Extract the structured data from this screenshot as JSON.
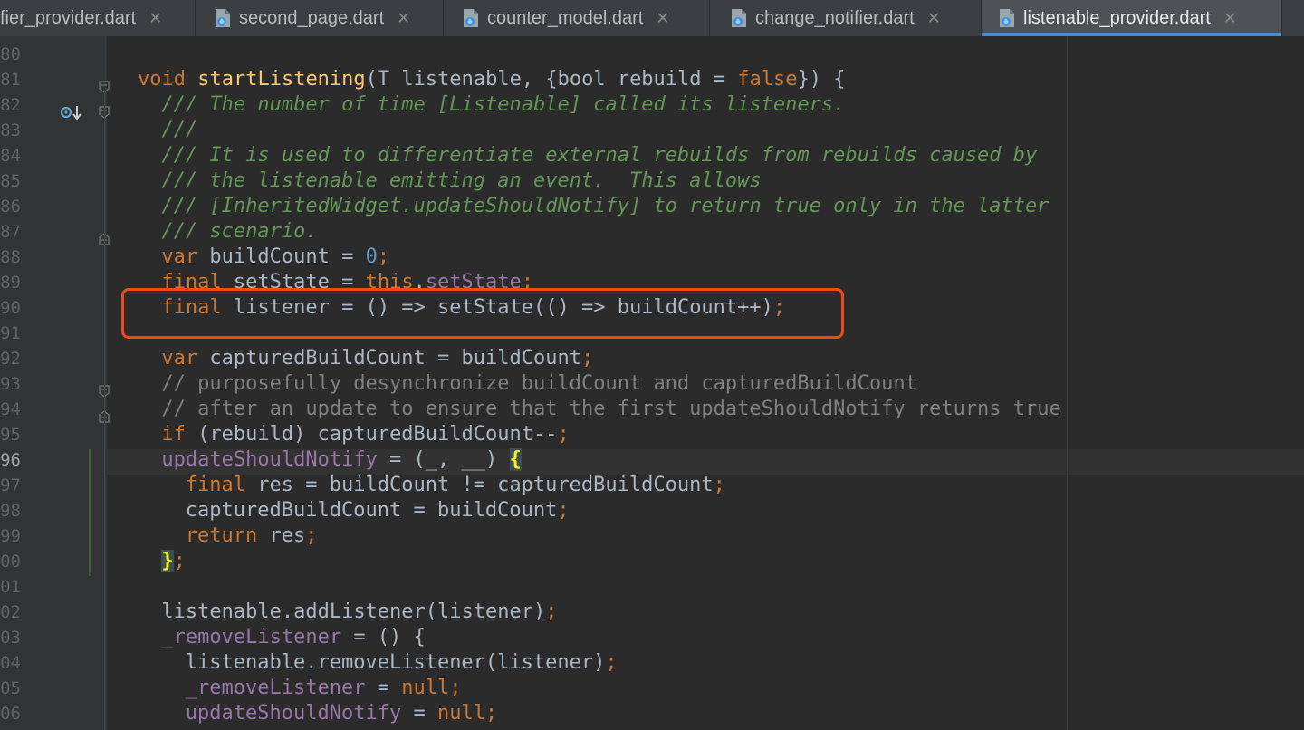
{
  "tabs": [
    {
      "label": "fier_provider.dart",
      "active": false
    },
    {
      "label": "second_page.dart",
      "active": false
    },
    {
      "label": "counter_model.dart",
      "active": false
    },
    {
      "label": "change_notifier.dart",
      "active": false
    },
    {
      "label": "listenable_provider.dart",
      "active": true
    }
  ],
  "tab_close_glyph": "✕",
  "icons": {
    "tab_file": "dart-file-icon",
    "gutter": "override-method-icon",
    "fold": "fold-marker-icon"
  },
  "highlight_color": "#f04a17",
  "current_line_number": "96",
  "lines": [
    {
      "num": "80",
      "segments": []
    },
    {
      "num": "81",
      "segments": [
        [
          "kw",
          "void "
        ],
        [
          "fn",
          "startListening"
        ],
        [
          "pl",
          "(T listenable, {"
        ],
        [
          "pl",
          "bool rebuild = "
        ],
        [
          "kw",
          "false"
        ],
        [
          "pl",
          "}) {"
        ]
      ]
    },
    {
      "num": "82",
      "segments": [
        [
          "doc",
          "/// The number of time [Listenable] called its listeners."
        ]
      ]
    },
    {
      "num": "83",
      "segments": [
        [
          "doc",
          "///"
        ]
      ]
    },
    {
      "num": "84",
      "segments": [
        [
          "doc",
          "/// It is used to differentiate external rebuilds from rebuilds caused by"
        ]
      ]
    },
    {
      "num": "85",
      "segments": [
        [
          "doc",
          "/// the listenable emitting an event.  This allows"
        ]
      ]
    },
    {
      "num": "86",
      "segments": [
        [
          "doc",
          "/// [InheritedWidget.updateShouldNotify] to return true only in the latter"
        ]
      ]
    },
    {
      "num": "87",
      "segments": [
        [
          "doc",
          "/// scenario."
        ]
      ]
    },
    {
      "num": "88",
      "segments": [
        [
          "kw",
          "var "
        ],
        [
          "pl",
          "buildCount = "
        ],
        [
          "num",
          "0"
        ],
        [
          "kw",
          ";"
        ]
      ]
    },
    {
      "num": "89",
      "segments": [
        [
          "kw",
          "final "
        ],
        [
          "pl",
          "setState = "
        ],
        [
          "kw",
          "this"
        ],
        [
          "pl",
          "."
        ],
        [
          "fld",
          "setState"
        ],
        [
          "kw",
          ";"
        ]
      ]
    },
    {
      "num": "90",
      "segments": [
        [
          "kw",
          "final "
        ],
        [
          "pl",
          "listener = () => setState(() => buildCount++)"
        ],
        [
          "kw",
          ";"
        ]
      ]
    },
    {
      "num": "91",
      "segments": []
    },
    {
      "num": "92",
      "segments": [
        [
          "kw",
          "var "
        ],
        [
          "pl",
          "capturedBuildCount = buildCount"
        ],
        [
          "kw",
          ";"
        ]
      ]
    },
    {
      "num": "93",
      "segments": [
        [
          "cmt",
          "// purposefully desynchronize buildCount and capturedBuildCount"
        ]
      ]
    },
    {
      "num": "94",
      "segments": [
        [
          "cmt",
          "// after an update to ensure that the first updateShouldNotify returns true"
        ]
      ]
    },
    {
      "num": "95",
      "segments": [
        [
          "kw",
          "if "
        ],
        [
          "pl",
          "(rebuild) capturedBuildCount--"
        ],
        [
          "kw",
          ";"
        ]
      ]
    },
    {
      "num": "96",
      "segments": [
        [
          "fld",
          "updateShouldNotify"
        ],
        [
          "pl",
          " = (_, __) "
        ],
        [
          "brace",
          "{"
        ]
      ]
    },
    {
      "num": "97",
      "segments": [
        [
          "kw",
          "final "
        ],
        [
          "pl",
          "res = buildCount != capturedBuildCount"
        ],
        [
          "kw",
          ";"
        ]
      ]
    },
    {
      "num": "98",
      "segments": [
        [
          "pl",
          "capturedBuildCount = buildCount"
        ],
        [
          "kw",
          ";"
        ]
      ]
    },
    {
      "num": "99",
      "segments": [
        [
          "kw",
          "return "
        ],
        [
          "pl",
          "res"
        ],
        [
          "kw",
          ";"
        ]
      ]
    },
    {
      "num": "00",
      "segments": [
        [
          "brace",
          "}"
        ],
        [
          "kw",
          ";"
        ]
      ]
    },
    {
      "num": "01",
      "segments": []
    },
    {
      "num": "02",
      "segments": [
        [
          "pl",
          "listenable.addListener(listener)"
        ],
        [
          "kw",
          ";"
        ]
      ]
    },
    {
      "num": "03",
      "segments": [
        [
          "fld",
          "_removeListener"
        ],
        [
          "pl",
          " = () {"
        ]
      ]
    },
    {
      "num": "04",
      "segments": [
        [
          "pl",
          "listenable.removeListener(listener)"
        ],
        [
          "kw",
          ";"
        ]
      ]
    },
    {
      "num": "05",
      "segments": [
        [
          "fld",
          "_removeListener"
        ],
        [
          "pl",
          " = "
        ],
        [
          "kw",
          "null;"
        ]
      ]
    },
    {
      "num": "06",
      "segments": [
        [
          "fld",
          "updateShouldNotify"
        ],
        [
          "pl",
          " = "
        ],
        [
          "kw",
          "null;"
        ]
      ]
    }
  ]
}
